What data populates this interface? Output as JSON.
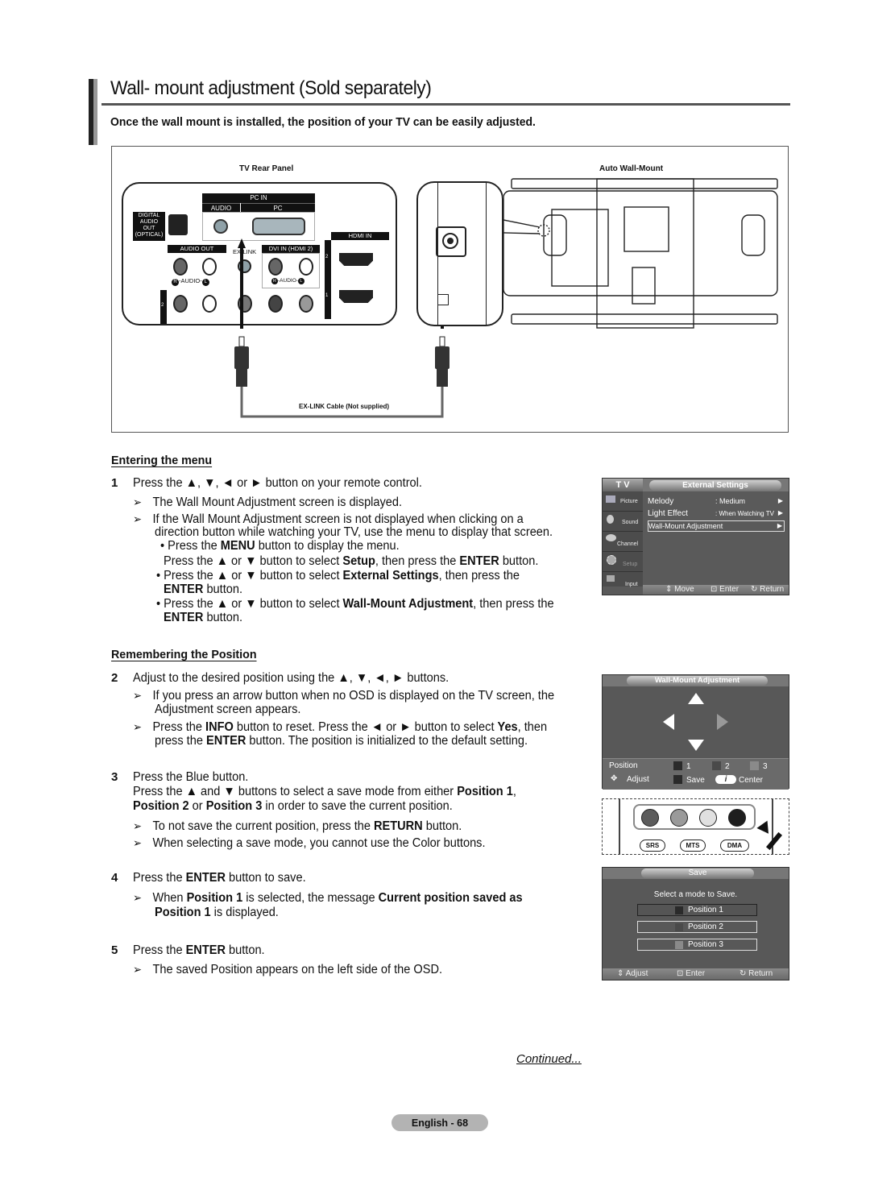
{
  "header": {
    "title": "Wall- mount adjustment (Sold separately)",
    "subtitle": "Once the wall mount is installed, the position of your TV can be easily adjusted."
  },
  "figure": {
    "rear_panel_label": "TV Rear Panel",
    "wall_mount_label": "Auto Wall-Mount",
    "cable_label": "EX-LINK Cable (Not supplied)",
    "ports": {
      "pc_in": "PC IN",
      "audio": "AUDIO",
      "pc": "PC",
      "digital_audio": [
        "DIGITAL",
        "AUDIO",
        "OUT",
        "(OPTICAL)"
      ],
      "audio_out": "AUDIO OUT",
      "ex_link": "EX-LINK",
      "dvi_in": "DVI IN (HDMI 2)",
      "hdmi_in": "HDMI IN",
      "audio_rl": "-AUDIO-",
      "r": "R",
      "l": "L",
      "hdmi2": "2",
      "hdmi1": "1",
      "comp2": "2"
    }
  },
  "sections": {
    "entering": {
      "heading": "Entering the menu",
      "step1_num": "1",
      "step1": "Press the ▲, ▼, ◄ or ► button on your remote control.",
      "note1": "The Wall Mount Adjustment screen is displayed.",
      "note2_l1": "If the Wall Mount Adjustment screen is not displayed when clicking on a",
      "note2_l2": "direction button while watching your TV, use the menu to display that screen.",
      "bullet1_pre": "• Press the ",
      "bullet1_b": "MENU",
      "bullet1_post": " button to display the menu.",
      "bullet1b_pre": "Press the ▲ or ▼ button to select ",
      "bullet1b_b1": "Setup",
      "bullet1b_mid": ", then press the ",
      "bullet1b_b2": "ENTER",
      "bullet1b_post": " button.",
      "bullet2_pre": "• Press the ▲ or ▼ button to select ",
      "bullet2_b": "External Settings",
      "bullet2_post": ", then press the",
      "bullet2_l2_b": "ENTER",
      "bullet2_l2_post": " button.",
      "bullet3_pre": "• Press the ▲ or ▼ button to select ",
      "bullet3_b": "Wall-Mount Adjustment",
      "bullet3_post": ", then press the",
      "bullet3_l2_b": "ENTER",
      "bullet3_l2_post": " button."
    },
    "remembering": {
      "heading": "Remembering the Position",
      "step2_num": "2",
      "step2": "Adjust to the desired position using the ▲, ▼, ◄, ► buttons.",
      "note3_l1": "If you press an arrow button when no OSD is displayed on the TV screen, the",
      "note3_l2": "Adjustment screen appears.",
      "note4_pre": "Press the ",
      "note4_b1": "INFO",
      "note4_mid": " button to reset. Press the ◄ or ► button to select ",
      "note4_b2": "Yes",
      "note4_post": ", then",
      "note4_l2_pre": "press the ",
      "note4_l2_b": "ENTER",
      "note4_l2_post": " button. The position is initialized to the default setting.",
      "step3_num": "3",
      "step3": "Press the Blue button.",
      "step3b_pre": "Press the ▲ and ▼ buttons to select a save mode from either ",
      "step3b_b1": "Position 1",
      "step3b_post": ",",
      "step3c_b1": "Position 2",
      "step3c_mid": " or ",
      "step3c_b2": "Position 3",
      "step3c_post": " in order to save the current position.",
      "note5_pre": "To not save the current position, press the ",
      "note5_b": "RETURN",
      "note5_post": " button.",
      "note6": "When selecting a save mode, you cannot use the Color buttons.",
      "step4_num": "4",
      "step4_pre": "Press the ",
      "step4_b": "ENTER",
      "step4_post": " button to save.",
      "note7_pre": "When ",
      "note7_b1": "Position 1",
      "note7_mid": " is selected, the message ",
      "note7_b2": "Current position saved as",
      "note7_l2_b": "Position 1",
      "note7_l2_post": " is displayed.",
      "step5_num": "5",
      "step5_pre": "Press the ",
      "step5_b": "ENTER",
      "step5_post": " button.",
      "note8": "The saved Position appears on the left side of the OSD."
    },
    "arrow_glyph": "➢"
  },
  "osd_external": {
    "tv_label": "T V",
    "title": "External Settings",
    "sidebar": [
      "Picture",
      "Sound",
      "Channel",
      "Setup",
      "Input"
    ],
    "rows": [
      {
        "label": "Melody",
        "value": ": Medium"
      },
      {
        "label": "Light Effect",
        "value": ": When Watching TV"
      },
      {
        "label": "Wall-Mount Adjustment",
        "value": ""
      }
    ],
    "footer": {
      "move": "Move",
      "enter": "Enter",
      "return": "Return"
    }
  },
  "osd_adjust": {
    "title": "Wall-Mount Adjustment",
    "position_label": "Position",
    "positions": [
      "1",
      "2",
      "3"
    ],
    "adjust_label": "Adjust",
    "save_label": "Save",
    "center_label": "Center",
    "info_glyph": "i"
  },
  "remote": {
    "buttons": [
      "SRS",
      "MTS",
      "DMA"
    ],
    "colors": [
      "#5c5c5c",
      "#9a9a9a",
      "#e0e0e0",
      "#1e1e1e"
    ]
  },
  "osd_save": {
    "title": "Save",
    "prompt": "Select a mode to Save.",
    "options": [
      "Position 1",
      "Position 2",
      "Position 3"
    ],
    "footer": {
      "adjust": "Adjust",
      "enter": "Enter",
      "return": "Return"
    }
  },
  "footer": {
    "continued": "Continued...",
    "page": "English - 68"
  }
}
